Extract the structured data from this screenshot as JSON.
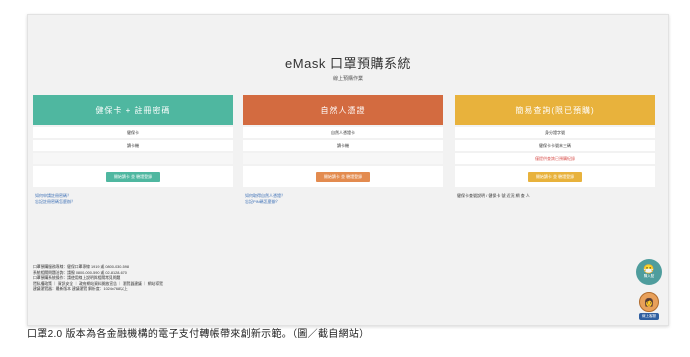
{
  "header": {
    "title": "eMask 口罩預購系統",
    "subtitle": "線上預購作業"
  },
  "columns": [
    {
      "color": "#4fb7a0",
      "title": "健保卡 + 註冊密碼",
      "rows": [
        "健保卡",
        "讀卡機",
        ""
      ],
      "button_label": "開始讀卡 並 驗證登錄",
      "button_color": "#4fb7a0",
      "links": [
        "如何申請註冊密碼？",
        "忘記註冊密碼怎麼辦？"
      ]
    },
    {
      "color": "#d36b40",
      "title": "自然人憑證",
      "rows": [
        "自然人憑證卡",
        "讀卡機",
        ""
      ],
      "button_label": "開始讀卡 並 驗證登錄",
      "button_color": "#e38b4f",
      "links": [
        "如何取得自然人憑證？",
        "忘記PIN碼怎麼辦？"
      ]
    },
    {
      "color": "#e8b23c",
      "title": "簡易查詢(限已預購)",
      "rows": [
        "身分證字號",
        "健保卡卡號末三碼",
        "僅提供查詢已預購紀錄"
      ],
      "button_label": "開始讀卡 並 驗證登錄",
      "button_color": "#e8b23c",
      "links": [
        "健保卡查號說明 / 健保卡 號 近況 網 查 人"
      ]
    }
  ],
  "footer": {
    "lines": [
      "口罩預購服務專線：健保口罩專線 1919 或 0800-030-598",
      "系統相關問題洽詢：請撥 0800-000-590 或 02-8128-670",
      "口罩預購系統操作：請使用線上說明與相關常見問題",
      "隱私權政策 ｜ 資訊安全 ｜ 政府網站資料開放宣告 ｜ 瀏覽器建議 ｜ 網站導覽",
      "建議瀏覽器：最新版本 建議瀏覽 解析度：1024x768以上"
    ]
  },
  "floating": {
    "mask_label": "購入點",
    "service_label": "線上客服"
  },
  "caption": "口罩2.0 版本為各金融機構的電子支付轉帳帶來創新示範。（圖／截自網站）"
}
